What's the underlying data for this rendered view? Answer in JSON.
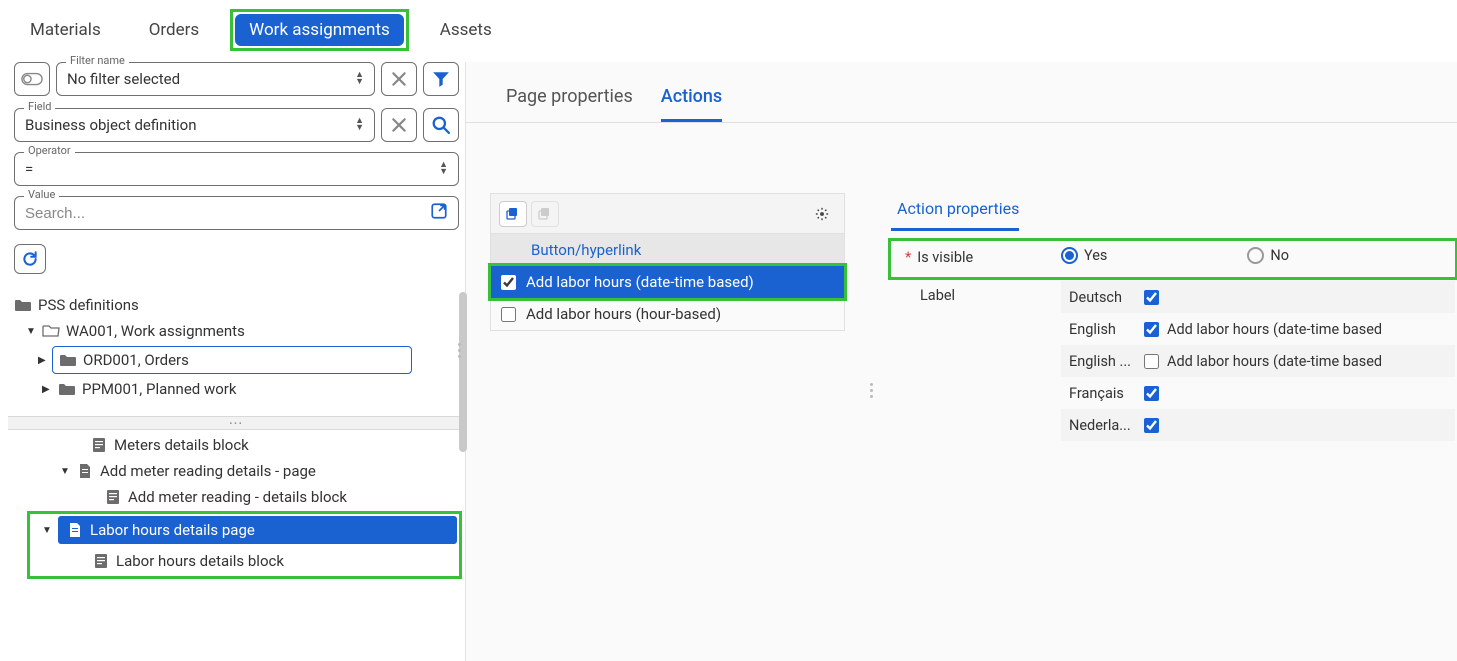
{
  "topTabs": {
    "materials": "Materials",
    "orders": "Orders",
    "work_assignments": "Work assignments",
    "assets": "Assets"
  },
  "filters": {
    "filter_name_label": "Filter name",
    "filter_name_value": "No filter selected",
    "field_label": "Field",
    "field_value": "Business object definition",
    "operator_label": "Operator",
    "operator_value": "=",
    "value_label": "Value",
    "value_placeholder": "Search..."
  },
  "tree_upper": {
    "root": "PSS definitions",
    "wa": "WA001, Work assignments",
    "ord": "ORD001, Orders",
    "ppm": "PPM001, Planned work"
  },
  "tree_lower": {
    "cutoff": "Meters details block",
    "add_meter_page": "Add meter reading details - page",
    "add_meter_block": "Add meter reading - details block",
    "labor_page": "Labor hours details page",
    "labor_block": "Labor hours details block"
  },
  "rightTabs": {
    "page_properties": "Page properties",
    "actions": "Actions"
  },
  "actionsList": {
    "header": "Button/hyperlink",
    "item1": "Add labor hours (date-time based)",
    "item2": "Add labor hours (hour-based)"
  },
  "actionProps": {
    "title": "Action properties",
    "is_visible_label": "Is visible",
    "yes": "Yes",
    "no": "No",
    "label_label": "Label",
    "langs": [
      {
        "name": "Deutsch",
        "checked": true,
        "value": ""
      },
      {
        "name": "English",
        "checked": true,
        "value": "Add labor hours (date-time based"
      },
      {
        "name": "English ...",
        "checked": false,
        "value": "Add labor hours (date-time based"
      },
      {
        "name": "Français",
        "checked": true,
        "value": ""
      },
      {
        "name": "Nederla...",
        "checked": true,
        "value": ""
      }
    ]
  }
}
